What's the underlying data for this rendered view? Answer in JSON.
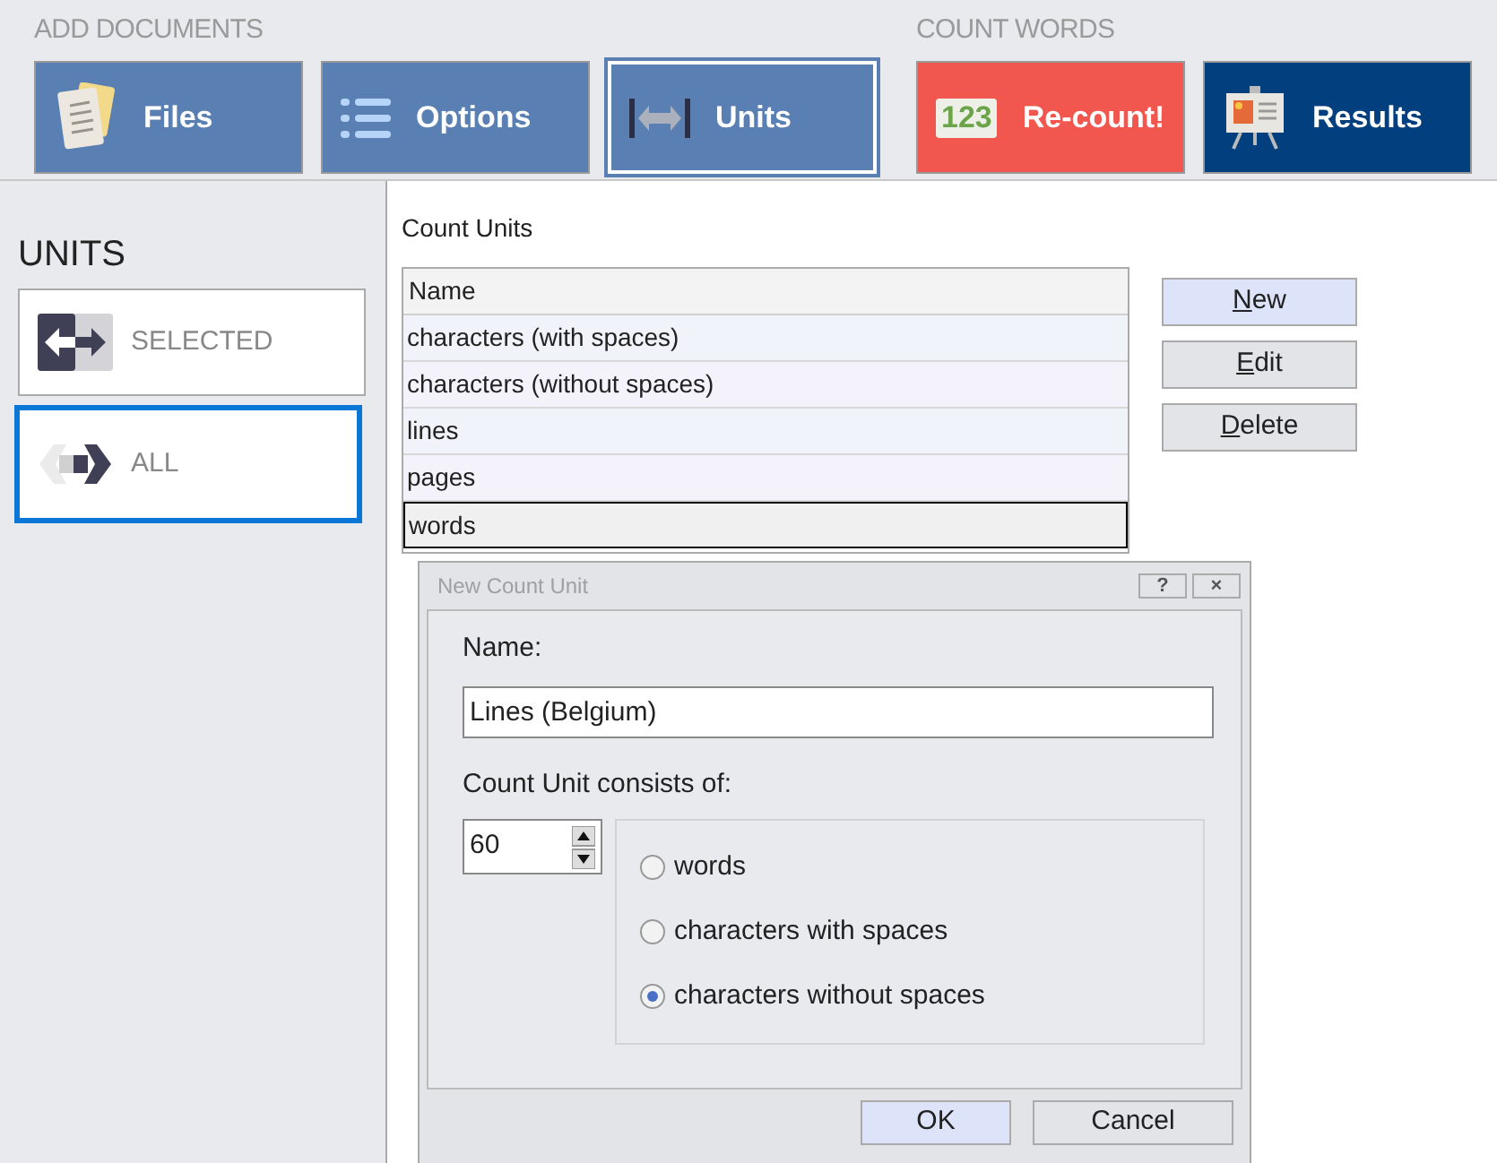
{
  "ribbon": {
    "groups": [
      {
        "label": "ADD DOCUMENTS",
        "buttons": [
          {
            "label": "Files",
            "kind": "files",
            "color": "#5a80b3",
            "selected": false
          },
          {
            "label": "Options",
            "kind": "options",
            "color": "#5a80b3",
            "selected": false
          },
          {
            "label": "Units",
            "kind": "units",
            "color": "#5a80b3",
            "selected": true
          }
        ]
      },
      {
        "label": "COUNT WORDS",
        "buttons": [
          {
            "label": "Re-count!",
            "kind": "recount",
            "badge": "123",
            "color": "#f2574f",
            "selected": false
          },
          {
            "label": "Results",
            "kind": "results",
            "color": "#023f7e",
            "selected": false
          }
        ]
      }
    ]
  },
  "sidebar": {
    "title": "UNITS",
    "items": [
      {
        "label": "SELECTED",
        "kind": "selected",
        "selected": false
      },
      {
        "label": "ALL",
        "kind": "all",
        "selected": true
      }
    ]
  },
  "panel": {
    "title": "Count Units",
    "table": {
      "columns": [
        "Name"
      ],
      "rows": [
        {
          "name": "characters (with spaces)",
          "selected": false
        },
        {
          "name": "characters (without spaces)",
          "selected": false
        },
        {
          "name": "lines",
          "selected": false
        },
        {
          "name": "pages",
          "selected": false
        },
        {
          "name": "words",
          "selected": true
        }
      ]
    },
    "buttons": [
      {
        "label": "New",
        "default": true
      },
      {
        "label": "Edit",
        "default": false
      },
      {
        "label": "Delete",
        "default": false
      }
    ]
  },
  "dialog": {
    "title": "New Count Unit",
    "title_buttons": [
      "?",
      "×"
    ],
    "name_label": "Name:",
    "name_value": "Lines (Belgium)",
    "consists_label": "Count Unit consists of:",
    "count_value": "60",
    "options": [
      {
        "label": "words",
        "selected": false
      },
      {
        "label": "characters with spaces",
        "selected": false
      },
      {
        "label": "characters without spaces",
        "selected": true
      }
    ],
    "buttons": [
      {
        "label": "OK",
        "default": true
      },
      {
        "label": "Cancel",
        "default": false
      }
    ]
  }
}
